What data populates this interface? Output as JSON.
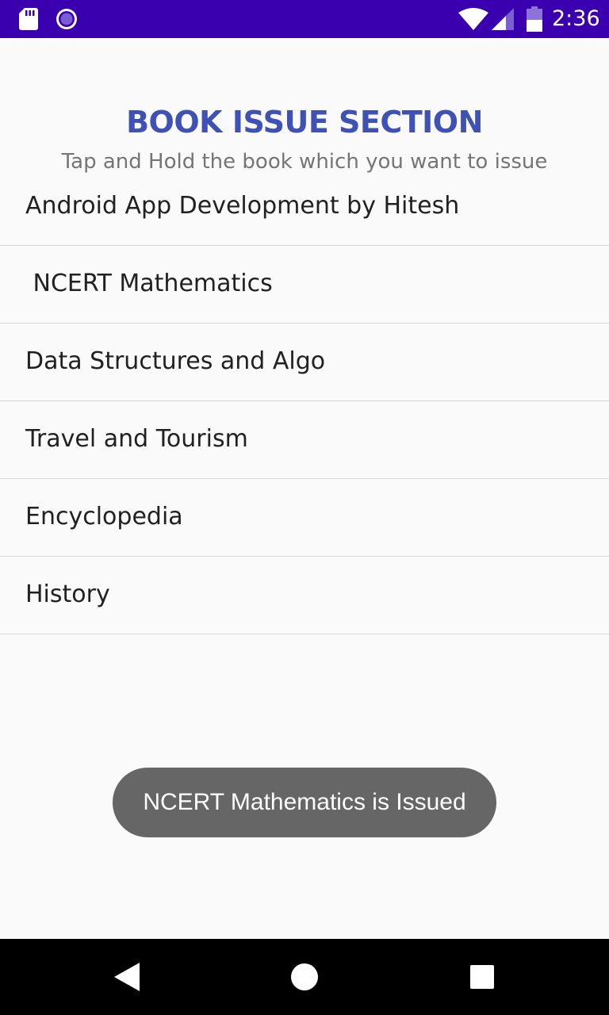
{
  "status_bar": {
    "time": "2:36",
    "background_color": "#3a00b0",
    "icons": [
      "sd-card-icon",
      "cast-icon",
      "wifi-icon",
      "signal-icon",
      "battery-icon"
    ]
  },
  "header": {
    "title": "BOOK ISSUE SECTION",
    "subtitle": "Tap and Hold the book which you want to issue",
    "title_color": "#3f51b5"
  },
  "books": [
    {
      "label": "Android App Development by Hitesh"
    },
    {
      "label": " NCERT Mathematics"
    },
    {
      "label": "Data Structures and Algo"
    },
    {
      "label": "Travel and Tourism"
    },
    {
      "label": "Encyclopedia"
    },
    {
      "label": "History"
    }
  ],
  "toast": {
    "message": "NCERT Mathematics is Issued"
  },
  "nav_bar": {
    "icons": [
      "back-icon",
      "home-icon",
      "recents-icon"
    ]
  }
}
